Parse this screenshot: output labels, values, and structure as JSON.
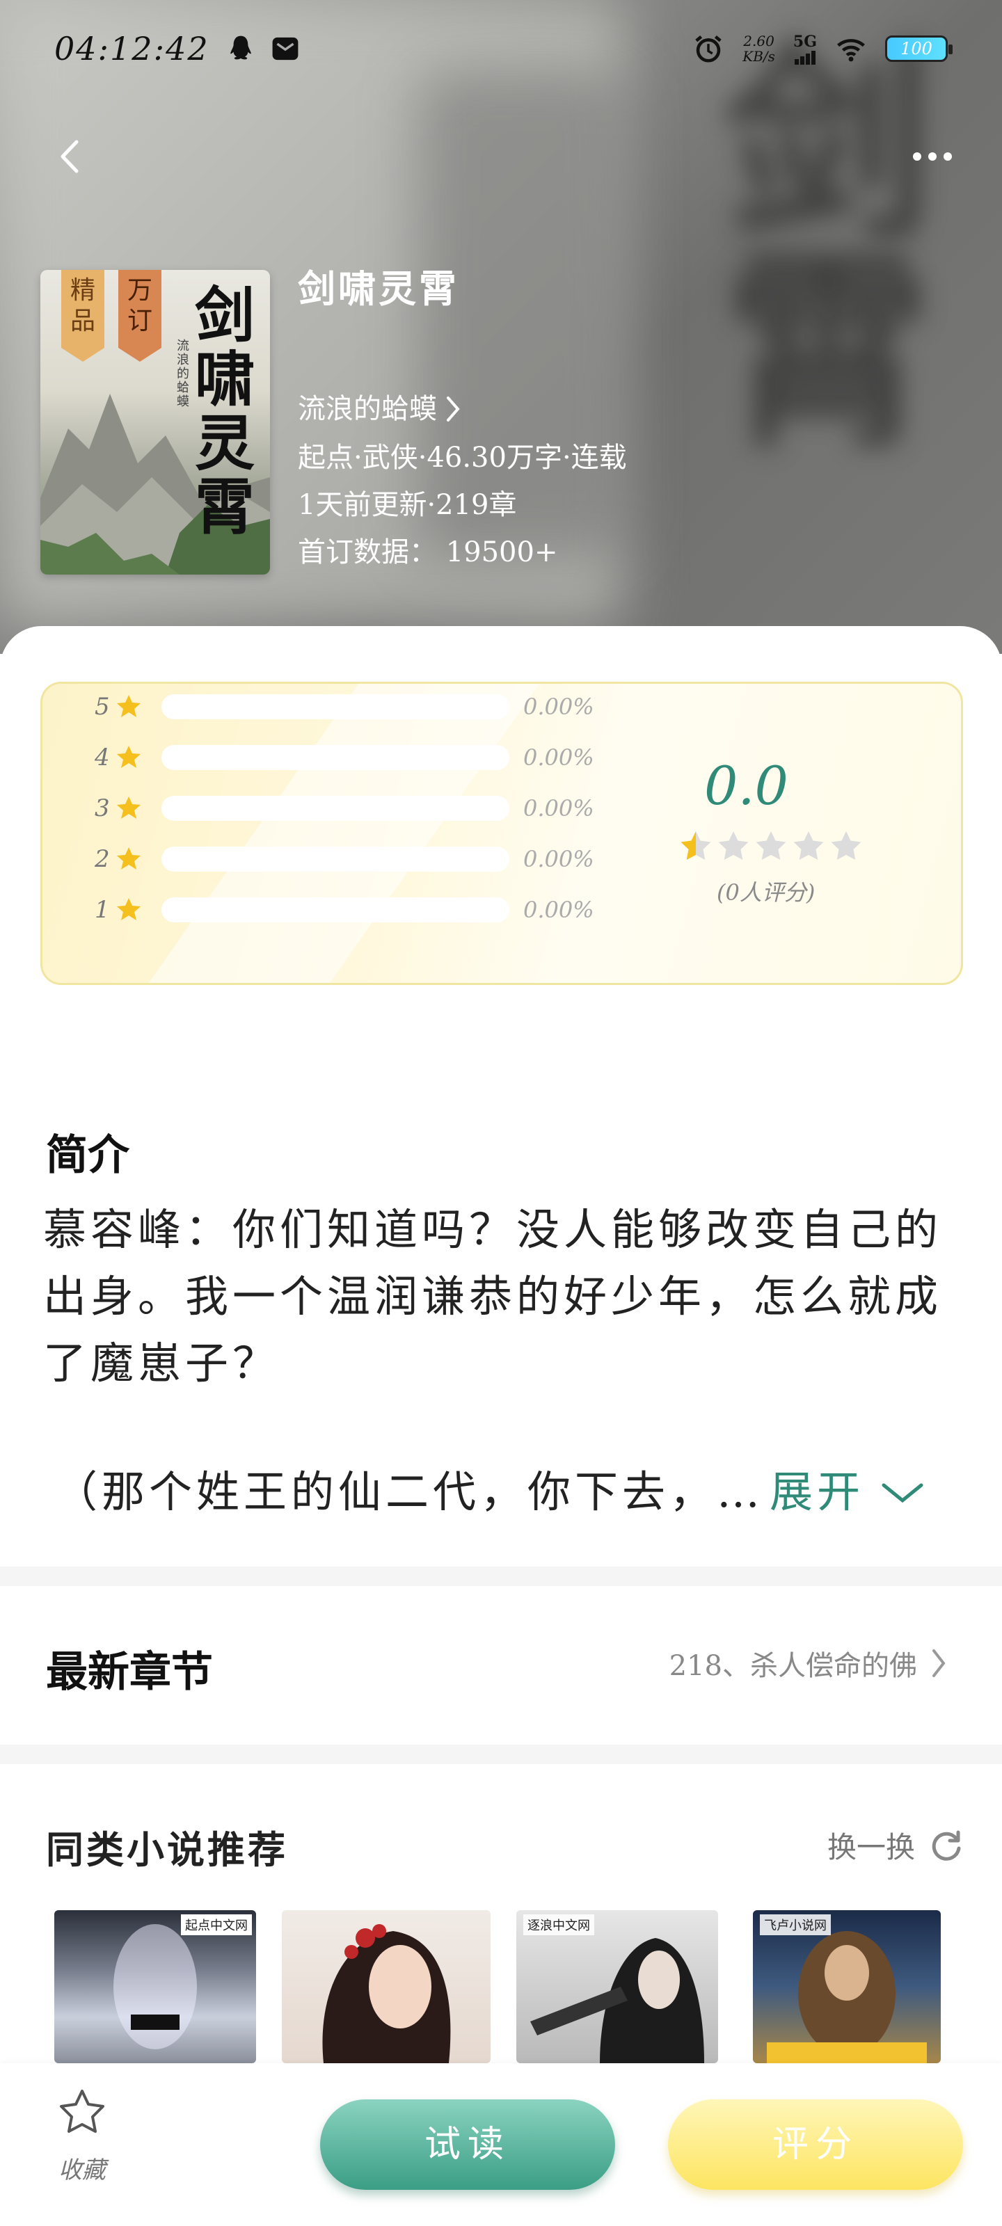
{
  "status_bar": {
    "time": "04:12:42",
    "net_speed_value": "2.60",
    "net_speed_unit": "KB/s",
    "network": "5G",
    "battery": "100"
  },
  "book": {
    "title": "剑啸灵霄",
    "author": "流浪的蛤蟆",
    "meta": "起点·武侠·46.30万字·连载",
    "update": "1天前更新·219章",
    "first_sub": "首订数据： 19500+",
    "cover_tags": [
      "精品",
      "万订"
    ],
    "cover_title": "剑啸灵霄",
    "cover_author": "流浪的蛤蟆"
  },
  "rating": {
    "score": "0.0",
    "stars": 0.5,
    "count_text": "(0人评分)",
    "rows": [
      {
        "level": "5",
        "pct": "0.00%",
        "fraction": 0
      },
      {
        "level": "4",
        "pct": "0.00%",
        "fraction": 0
      },
      {
        "level": "3",
        "pct": "0.00%",
        "fraction": 0
      },
      {
        "level": "2",
        "pct": "0.00%",
        "fraction": 0
      },
      {
        "level": "1",
        "pct": "0.00%",
        "fraction": 0
      }
    ]
  },
  "intro": {
    "title": "简介",
    "text": "慕容峰：你们知道吗？没人能够改变自己的出身。我一个温润谦恭的好少年，怎么就成了魔崽子？",
    "more": "（那个姓王的仙二代，你下去，…",
    "expand": "展开"
  },
  "latest": {
    "title": "最新章节",
    "chapter": "218、杀人偿命的佛"
  },
  "recommend": {
    "title": "同类小说推荐",
    "refresh": "换一换",
    "books": [
      {
        "publisher": "起点中文网"
      },
      {
        "publisher": ""
      },
      {
        "publisher": "逐浪中文网"
      },
      {
        "publisher": "飞卢小说网"
      }
    ]
  },
  "bottom": {
    "favorite": "收藏",
    "try_read": "试读",
    "rate": "评分"
  },
  "colors": {
    "accent": "#2f8a77",
    "rate_button": "#fde561",
    "read_button": "#3b9e85"
  }
}
